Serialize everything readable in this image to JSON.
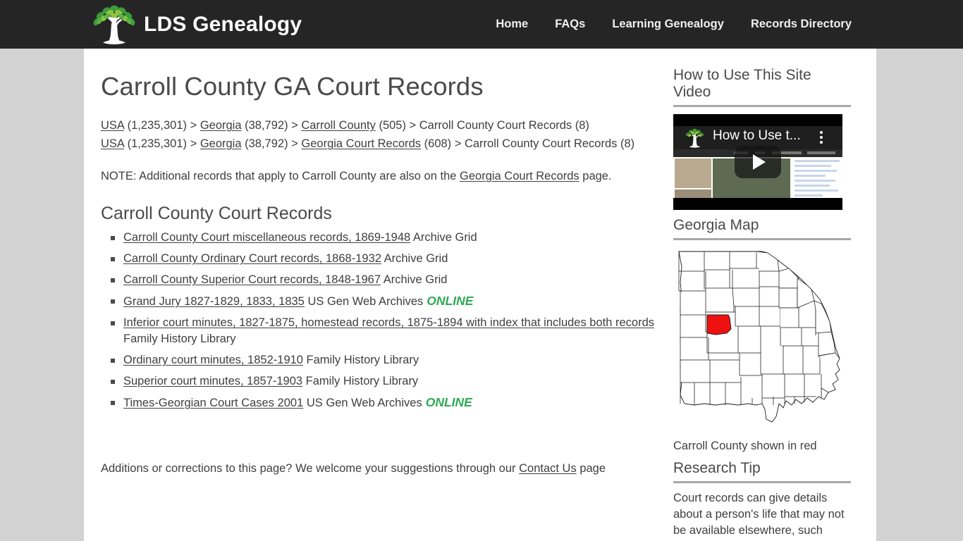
{
  "header": {
    "brand_name": "LDS Genealogy",
    "logo_icon": "tree-logo-icon",
    "nav": [
      {
        "label": "Home"
      },
      {
        "label": "FAQs"
      },
      {
        "label": "Learning Genealogy"
      },
      {
        "label": "Records Directory"
      }
    ]
  },
  "main": {
    "title": "Carroll County GA Court Records",
    "breadcrumbs": [
      {
        "parts": [
          {
            "text": "USA",
            "link": true
          },
          {
            "text": " (1,235,301) > ",
            "link": false
          },
          {
            "text": "Georgia",
            "link": true
          },
          {
            "text": " (38,792) > ",
            "link": false
          },
          {
            "text": "Carroll County",
            "link": true
          },
          {
            "text": " (505) > Carroll County Court Records (8)",
            "link": false
          }
        ]
      },
      {
        "parts": [
          {
            "text": "USA",
            "link": true
          },
          {
            "text": " (1,235,301) > ",
            "link": false
          },
          {
            "text": "Georgia",
            "link": true
          },
          {
            "text": " (38,792) > ",
            "link": false
          },
          {
            "text": "Georgia Court Records",
            "link": true
          },
          {
            "text": " (608) > Carroll County Court Records (8)",
            "link": false
          }
        ]
      }
    ],
    "note_prefix": "NOTE: Additional records that apply to Carroll County are also on the ",
    "note_link": "Georgia Court Records",
    "note_suffix": " page.",
    "section_title": "Carroll County Court Records",
    "records": [
      {
        "title": "Carroll County Court miscellaneous records, 1869-1948",
        "source": "Archive Grid",
        "online": ""
      },
      {
        "title": "Carroll County Ordinary Court records, 1868-1932",
        "source": "Archive Grid",
        "online": ""
      },
      {
        "title": "Carroll County Superior Court records, 1848-1967",
        "source": "Archive Grid",
        "online": ""
      },
      {
        "title": "Grand Jury 1827-1829, 1833, 1835",
        "source": "US Gen Web Archives",
        "online": "ONLINE"
      },
      {
        "title": "Inferior court minutes, 1827-1875, homestead records, 1875-1894 with index that includes both records",
        "source": "Family History Library",
        "online": ""
      },
      {
        "title": "Ordinary court minutes, 1852-1910",
        "source": "Family History Library",
        "online": ""
      },
      {
        "title": "Superior court minutes, 1857-1903",
        "source": "Family History Library",
        "online": ""
      },
      {
        "title": "Times-Georgian Court Cases 2001",
        "source": "US Gen Web Archives",
        "online": "ONLINE"
      }
    ],
    "footer_prefix": "Additions or corrections to this page? We welcome your suggestions through our ",
    "footer_link": "Contact Us",
    "footer_suffix": " page"
  },
  "sidebar": {
    "video_widget": {
      "title": "How to Use This Site Video",
      "player_title": "How to Use t...",
      "play_icon": "play-button-icon",
      "menu_icon": "kebab-menu-icon",
      "logo_icon": "tree-logo-icon"
    },
    "map_widget": {
      "title": "Georgia Map",
      "caption": "Carroll County shown in red",
      "highlight_color": "#ee1111",
      "map_icon": "georgia-county-map-icon"
    },
    "tip_widget": {
      "title": "Research Tip",
      "text": "Court records can give details about a person's life that may not be available elsewhere, such"
    }
  },
  "colors": {
    "header_bg": "#252525",
    "page_bg": "#d2d2d2",
    "content_bg": "#ffffff",
    "text": "#3f3f3f",
    "heading": "#4a4a4a",
    "online_green": "#2faa55",
    "rule": "#a8a8a8"
  }
}
